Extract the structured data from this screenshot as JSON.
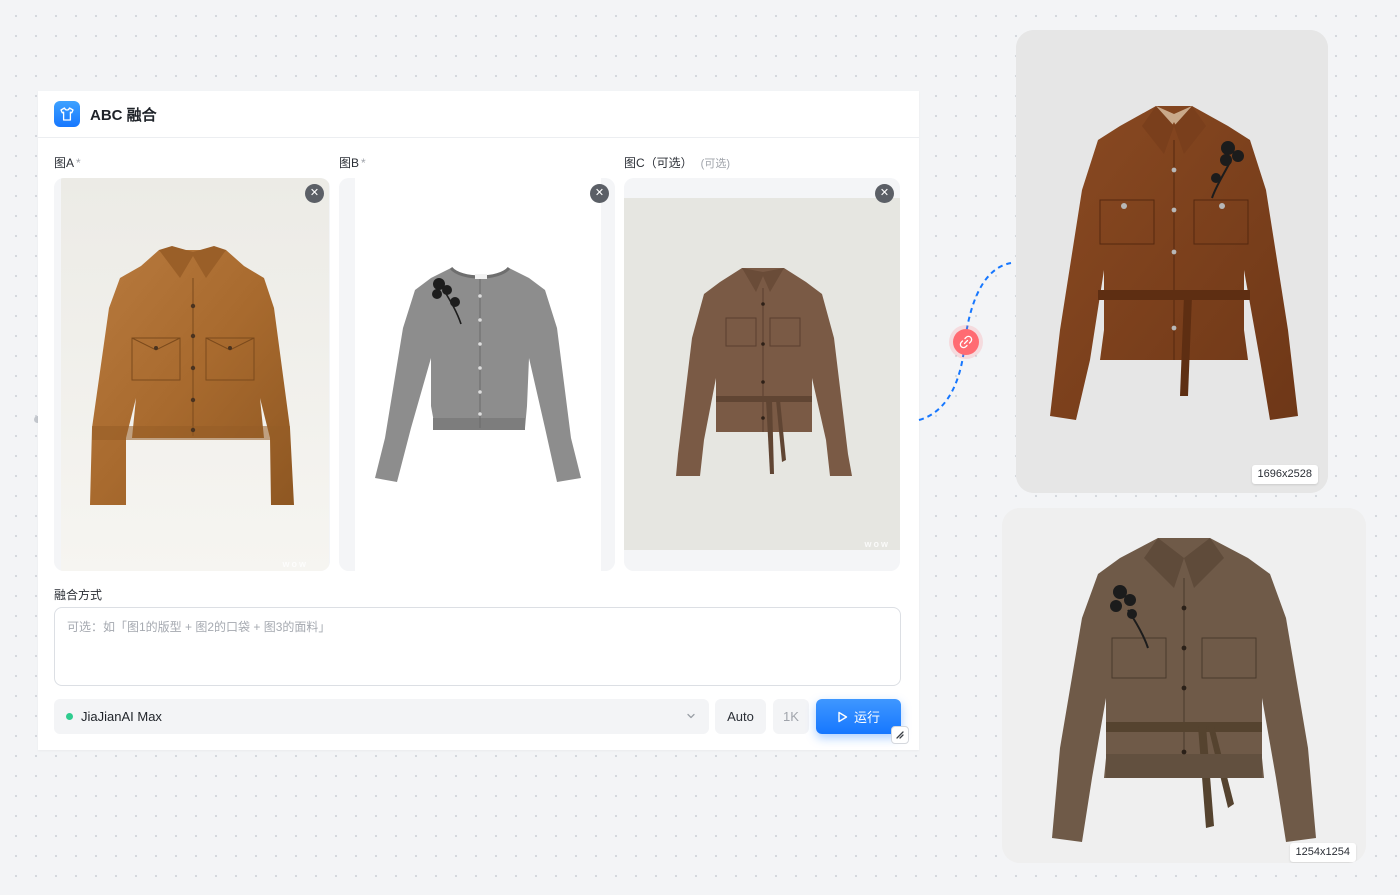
{
  "app": {
    "title": "ABC 融合",
    "icon": "tshirt-icon",
    "accent": "#1677ff"
  },
  "slots": [
    {
      "label": "图A",
      "required_mark": "*",
      "optional_note": ""
    },
    {
      "label": "图B",
      "required_mark": "*",
      "optional_note": ""
    },
    {
      "label": "图C（可选）",
      "required_mark": "",
      "optional_note": "(可选)"
    }
  ],
  "watermark": "wow",
  "blend": {
    "label": "融合方式",
    "placeholder": "可选：如「图1的版型 + 图2的口袋 + 图3的面料」",
    "value": ""
  },
  "toolbar": {
    "model": "JiaJianAI Max",
    "model_status_color": "#2ecc8f",
    "aspect": "Auto",
    "resolution": "1K",
    "run_label": "运行"
  },
  "outputs": [
    {
      "size_label": "1696x2528"
    },
    {
      "size_label": "1254x1254"
    }
  ],
  "colors": {
    "connector": "#1677ff",
    "link_node": "#ff6b72"
  }
}
